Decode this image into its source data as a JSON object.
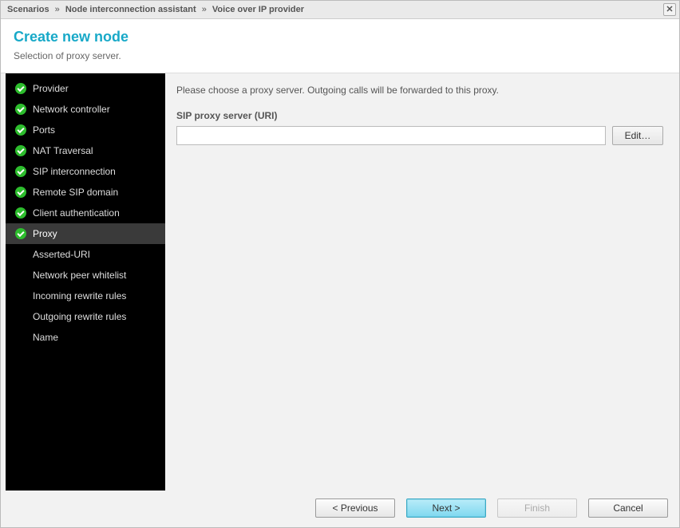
{
  "titlebar": {
    "crumbs": [
      "Scenarios",
      "Node interconnection assistant",
      "Voice over IP provider"
    ],
    "sep": "»"
  },
  "header": {
    "title": "Create new node",
    "subtitle": "Selection of proxy server."
  },
  "sidebar": {
    "items": [
      {
        "label": "Provider",
        "done": true,
        "selected": false
      },
      {
        "label": "Network controller",
        "done": true,
        "selected": false
      },
      {
        "label": "Ports",
        "done": true,
        "selected": false
      },
      {
        "label": "NAT Traversal",
        "done": true,
        "selected": false
      },
      {
        "label": "SIP interconnection",
        "done": true,
        "selected": false
      },
      {
        "label": "Remote SIP domain",
        "done": true,
        "selected": false
      },
      {
        "label": "Client authentication",
        "done": true,
        "selected": false
      },
      {
        "label": "Proxy",
        "done": true,
        "selected": true
      },
      {
        "label": "Asserted-URI",
        "done": false,
        "selected": false
      },
      {
        "label": "Network peer whitelist",
        "done": false,
        "selected": false
      },
      {
        "label": "Incoming rewrite rules",
        "done": false,
        "selected": false
      },
      {
        "label": "Outgoing rewrite rules",
        "done": false,
        "selected": false
      },
      {
        "label": "Name",
        "done": false,
        "selected": false
      }
    ]
  },
  "main": {
    "instruction": "Please choose a proxy server. Outgoing calls will be forwarded to this proxy.",
    "field_label": "SIP proxy server (URI)",
    "field_value": "",
    "edit_label": "Edit…"
  },
  "footer": {
    "prev": "< Previous",
    "next": "Next >",
    "finish": "Finish",
    "cancel": "Cancel"
  }
}
